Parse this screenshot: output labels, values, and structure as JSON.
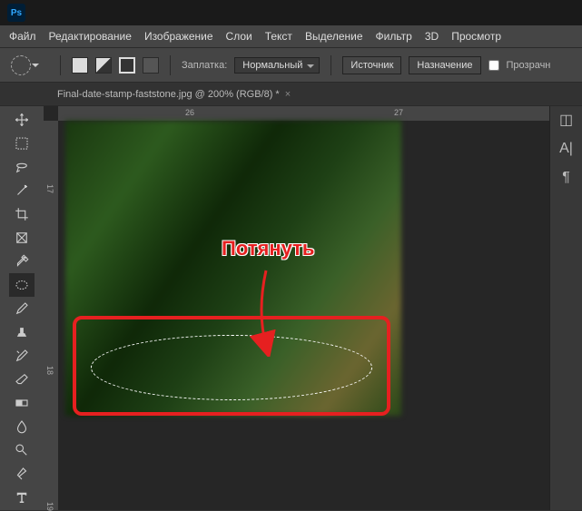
{
  "menu": {
    "file": "Файл",
    "edit": "Редактирование",
    "image": "Изображение",
    "layer": "Слои",
    "type": "Текст",
    "select": "Выделение",
    "filter": "Фильтр",
    "threeD": "3D",
    "view": "Просмотр"
  },
  "options": {
    "patch_label": "Заплатка:",
    "mode": "Нормальный",
    "source": "Источник",
    "destination": "Назначение",
    "transparent_label": "Прозрачн"
  },
  "tab": {
    "title": "Final-date-stamp-faststone.jpg @ 200% (RGB/8) *",
    "close": "×"
  },
  "ruler": {
    "h1": "26",
    "h2": "27",
    "v1": "17",
    "v2": "18",
    "v3": "19"
  },
  "annotation": {
    "text": "Потянуть"
  },
  "icons": {
    "ps": "Ps",
    "character": "A|",
    "paragraph": "¶",
    "histogram": "◫"
  }
}
